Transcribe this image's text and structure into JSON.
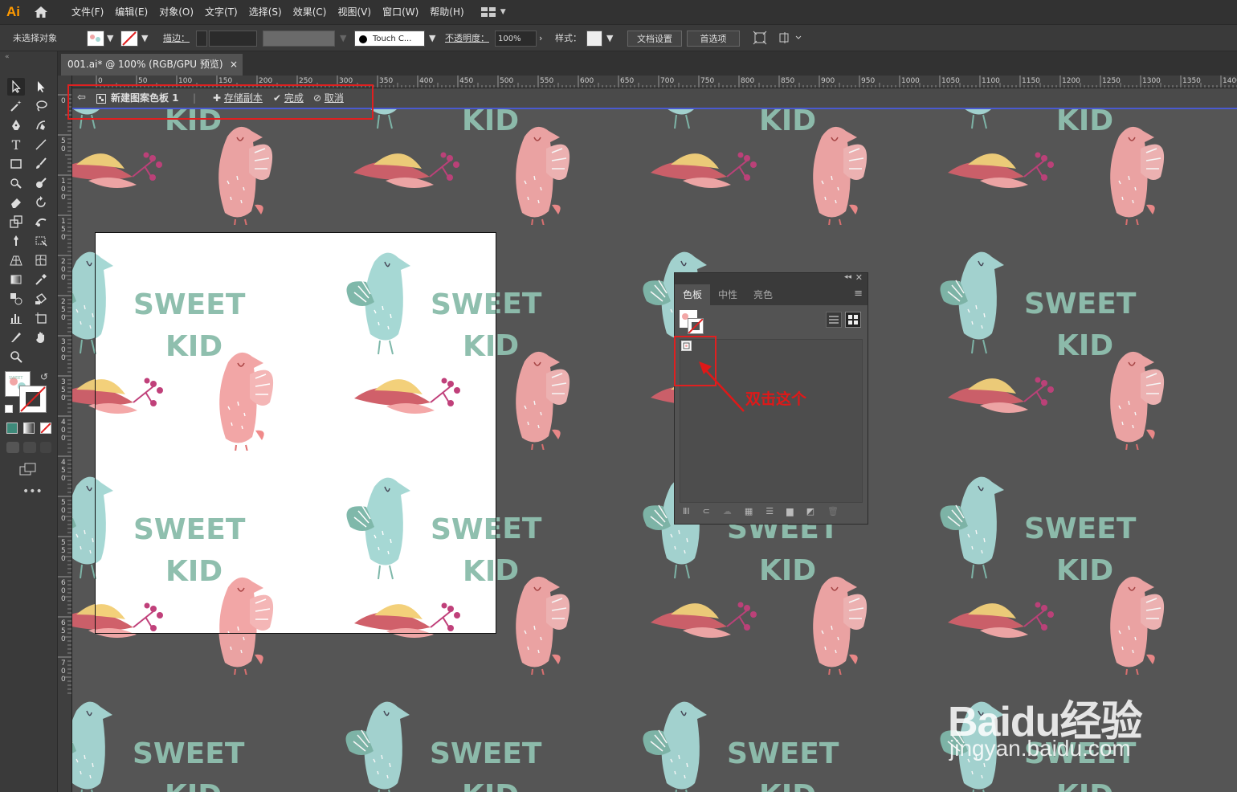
{
  "app": {
    "logo": "Ai"
  },
  "menu": [
    "文件(F)",
    "编辑(E)",
    "对象(O)",
    "文字(T)",
    "选择(S)",
    "效果(C)",
    "视图(V)",
    "窗口(W)",
    "帮助(H)"
  ],
  "controlbar": {
    "selection": "未选择对象",
    "stroke_label": "描边：",
    "brush": "Touch C...",
    "opacity_label": "不透明度：",
    "opacity": "100%",
    "style_label": "样式：",
    "doc_setup": "文档设置",
    "preferences": "首选项"
  },
  "document": {
    "tab": "001.ai* @ 100% (RGB/GPU 预览)",
    "close": "×"
  },
  "ruler": {
    "top_ticks": [
      "0",
      "50",
      "100",
      "150",
      "200",
      "250",
      "300",
      "350",
      "400",
      "450",
      "500",
      "550",
      "600",
      "650",
      "700",
      "750",
      "800",
      "850",
      "900",
      "950",
      "1000",
      "1050",
      "1100",
      "1150",
      "1200",
      "1250",
      "1300",
      "1350",
      "1400"
    ],
    "left_ticks": [
      "0",
      "50",
      "100",
      "150",
      "200",
      "250",
      "300",
      "350",
      "400",
      "450",
      "500",
      "550",
      "600",
      "650",
      "700"
    ]
  },
  "pattern_bar": {
    "name": "新建图案色板 1",
    "save_copy": "存储副本",
    "done": "完成",
    "cancel": "取消"
  },
  "motif": {
    "word1": "SWEET",
    "word2": "KID"
  },
  "swatches_panel": {
    "tabs": [
      "色板",
      "中性",
      "亮色"
    ]
  },
  "annotation": "双击这个",
  "watermark": {
    "logo": "Baidu经验",
    "url": "jingyan.baidu.com"
  },
  "colors": {
    "accent_red": "#e02020",
    "teal": "#a6d8d4",
    "pink": "#f2a6a6",
    "leaf": "#d0606a",
    "yellow": "#f3d07a",
    "berry": "#c0407a",
    "ai_orange": "#ff9a00"
  }
}
